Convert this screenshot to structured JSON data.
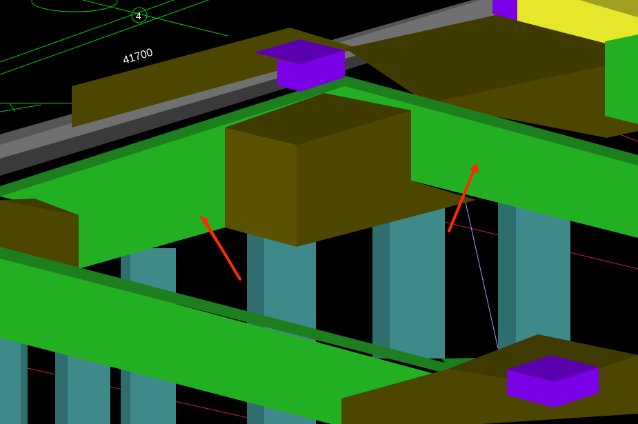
{
  "viewport": {
    "background": "#000000",
    "axis_bubble_label": "4",
    "dimension_label": "41700"
  },
  "colors": {
    "slab_green": "#22b022",
    "slab_green_dark": "#1c7e1c",
    "beam_olive_top": "#3f3a00",
    "beam_olive_side": "#4d4600",
    "beam_olive_front": "#5a5200",
    "column_cyan": "#3e8a8a",
    "column_cyan_light": "#4fa0a0",
    "gray_beam": "#707070",
    "gray_beam_dark": "#555555",
    "purple_block": "#7a00e6",
    "purple_block_top": "#5a00b0",
    "yellow_block": "#e6e62a",
    "axis_line_green": "#00d000",
    "grid_line_red": "#d02020",
    "guide_line_blue": "#9aa0ff",
    "annotation_arrow_red": "#ff2a00"
  },
  "annotations": [
    {
      "name": "arrow-left",
      "color": "#ff2a00"
    },
    {
      "name": "arrow-right",
      "color": "#ff2a00"
    }
  ]
}
